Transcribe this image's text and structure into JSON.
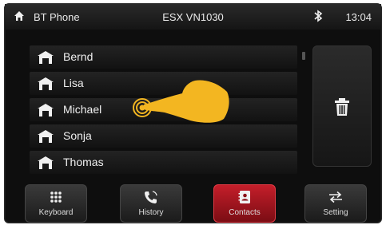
{
  "status_bar": {
    "app_name": "BT Phone",
    "device_model": "ESX VN1030",
    "time": "13:04"
  },
  "contacts": [
    {
      "name": "Bernd"
    },
    {
      "name": "Lisa"
    },
    {
      "name": "Michael"
    },
    {
      "name": "Sonja"
    },
    {
      "name": "Thomas"
    }
  ],
  "bottom_nav": {
    "keyboard_label": "Keyboard",
    "history_label": "History",
    "contacts_label": "Contacts",
    "setting_label": "Setting",
    "active_tab": "Contacts"
  },
  "colors": {
    "accent_red": "#c41e2a",
    "touch_hint": "#f3b621"
  },
  "icons": {
    "home": "home-icon",
    "bluetooth": "bluetooth-icon",
    "contact": "house-contact-icon",
    "delete": "trash-icon",
    "keyboard": "keypad-icon",
    "history": "phone-icon",
    "contacts": "address-book-icon",
    "setting": "swap-arrows-icon",
    "hint": "tap-hand-icon"
  }
}
